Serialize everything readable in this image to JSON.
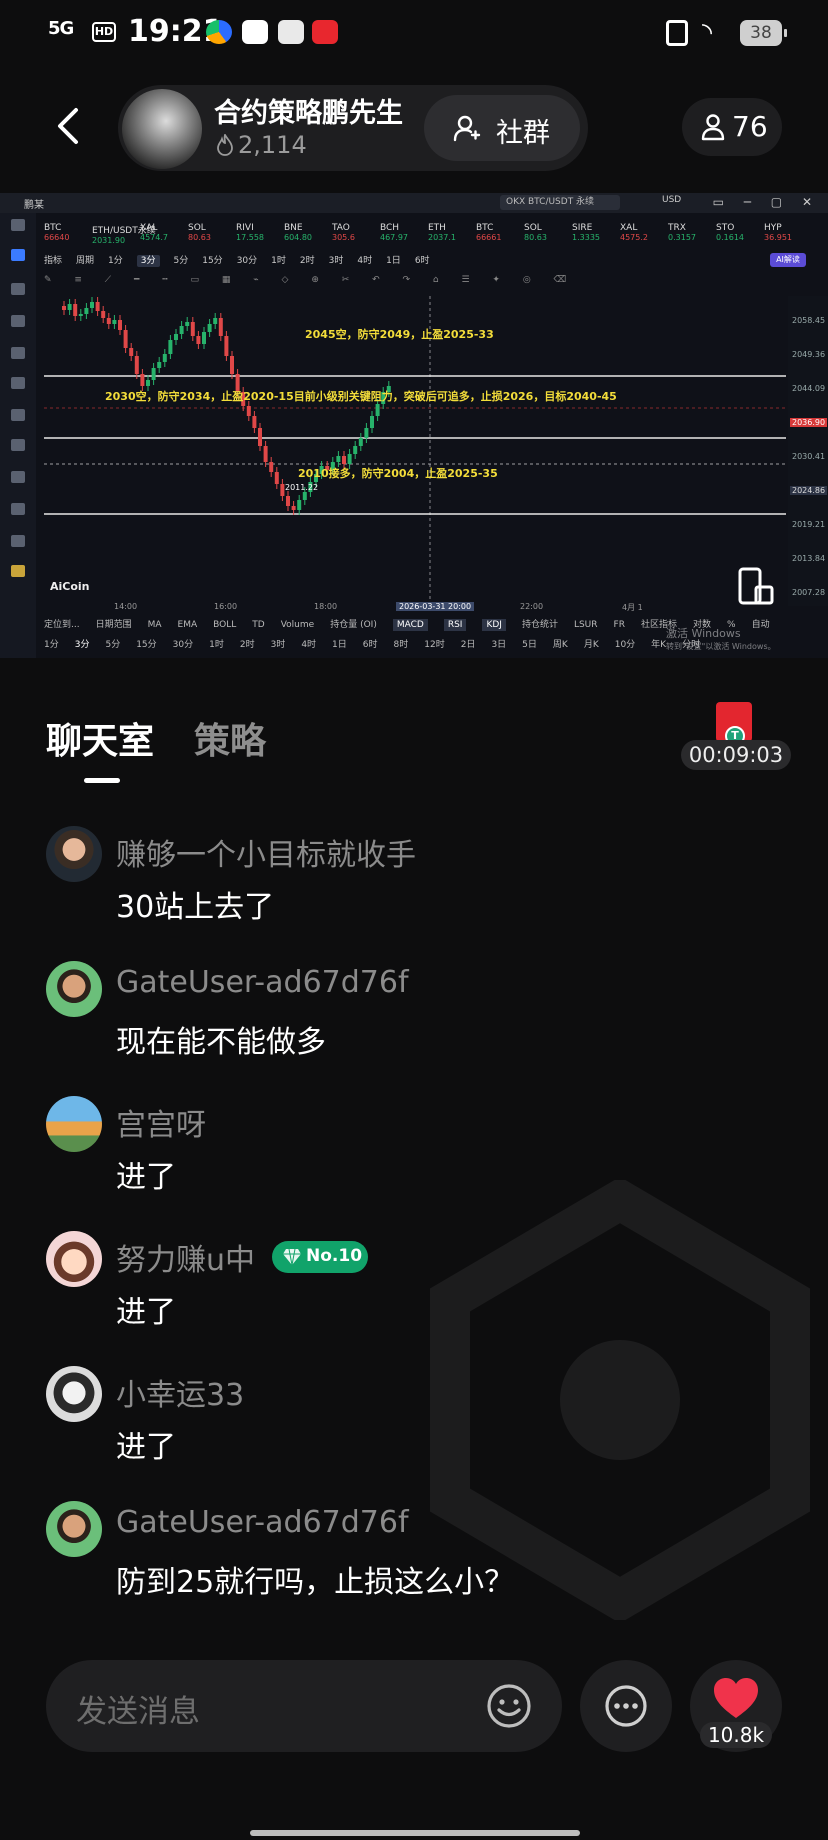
{
  "status_bar": {
    "network": "5G",
    "hd": "HD",
    "time": "19:21",
    "battery": "38"
  },
  "header": {
    "host_name": "合约策略鹏先生",
    "heat": "2,114",
    "community_label": "社群",
    "viewer_count": "76"
  },
  "chart_screen": {
    "window_title": "鹏某",
    "pair_search": "OKX BTC/USDT 永续",
    "currency": "USD",
    "tickers": [
      {
        "sym": "BTC",
        "price": "66640"
      },
      {
        "sym": "ETH/USDT永续",
        "price": "2031.90"
      },
      {
        "sym": "XAL",
        "price": "4574.7"
      },
      {
        "sym": "SOL",
        "price": "80.63"
      },
      {
        "sym": "RIVI",
        "price": "17.558"
      },
      {
        "sym": "BNE",
        "price": "604.80"
      },
      {
        "sym": "TAO",
        "price": "305.6"
      },
      {
        "sym": "BCH",
        "price": "467.97"
      },
      {
        "sym": "ETH",
        "price": "2037.1"
      },
      {
        "sym": "BTC",
        "price": "66661"
      },
      {
        "sym": "SOL",
        "price": "80.63"
      },
      {
        "sym": "SIRE",
        "price": "1.3335"
      },
      {
        "sym": "XAL",
        "price": "4575.2"
      },
      {
        "sym": "TRX",
        "price": "0.3157"
      },
      {
        "sym": "STO",
        "price": "0.1614"
      },
      {
        "sym": "HYP",
        "price": "36.951"
      }
    ],
    "periods_top": [
      "指标",
      "周期",
      "1分",
      "3分",
      "5分",
      "15分",
      "30分",
      "1时",
      "2时",
      "3时",
      "4时",
      "1日",
      "6时"
    ],
    "selected_period": "3分",
    "ai_label": "AI解读",
    "annotations": [
      "2045空，防守2049，止盈2025-33",
      "2030空，防守2034，止盈2020-15目前小级别关键阻力，突破后可追多，止损2026，目标2040-45",
      "2010接多，防守2004，止盈2025-35"
    ],
    "low_label": "2011.22",
    "price_levels": [
      "2058.45",
      "2049.36",
      "2044.09",
      "2036.90",
      "2030.41",
      "2024.86",
      "2019.21",
      "2013.84",
      "2007.28"
    ],
    "time_labels": [
      "14:00",
      "16:00",
      "18:00",
      "2026-03-31 20:00",
      "22:00",
      "4月 1"
    ],
    "indicators": [
      "定位到...",
      "日期范围",
      "MA",
      "EMA",
      "BOLL",
      "TD",
      "Volume",
      "持仓量 (OI)",
      "MACD",
      "RSI",
      "KDJ",
      "持仓统计",
      "LSUR",
      "FR",
      "社区指标",
      "对数",
      "%",
      "自动"
    ],
    "periods_bottom": [
      "1分",
      "3分",
      "5分",
      "15分",
      "30分",
      "1时",
      "2时",
      "3时",
      "4时",
      "1日",
      "6时",
      "8时",
      "12时",
      "2日",
      "3日",
      "5日",
      "周K",
      "月K",
      "10分",
      "年K",
      "分时"
    ],
    "brand": "AiCoin",
    "windows_activate": "激活 Windows",
    "windows_activate_sub": "转到\"设置\"以激活 Windows。"
  },
  "tabs": {
    "chat": "聊天室",
    "strategy": "策略"
  },
  "timer": "00:09:03",
  "messages": [
    {
      "user": "赚够一个小目标就收手",
      "text": "30站上去了"
    },
    {
      "user": "GateUser-ad67d76f",
      "text": "现在能不能做多"
    },
    {
      "user": "宫宫呀",
      "text": "进了"
    },
    {
      "user": "努力赚u中",
      "badge": "No.10",
      "text": "进了"
    },
    {
      "user": "小幸运33",
      "text": "进了"
    },
    {
      "user": "GateUser-ad67d76f",
      "text": "防到25就行吗，止损这么小？"
    }
  ],
  "input": {
    "placeholder": "发送消息"
  },
  "likes": "10.8k",
  "colors": {
    "background": "#0d0d0e",
    "accent_green": "#11a36a",
    "like_red": "#f0334b",
    "annotation_yellow": "#f3dd3a"
  }
}
